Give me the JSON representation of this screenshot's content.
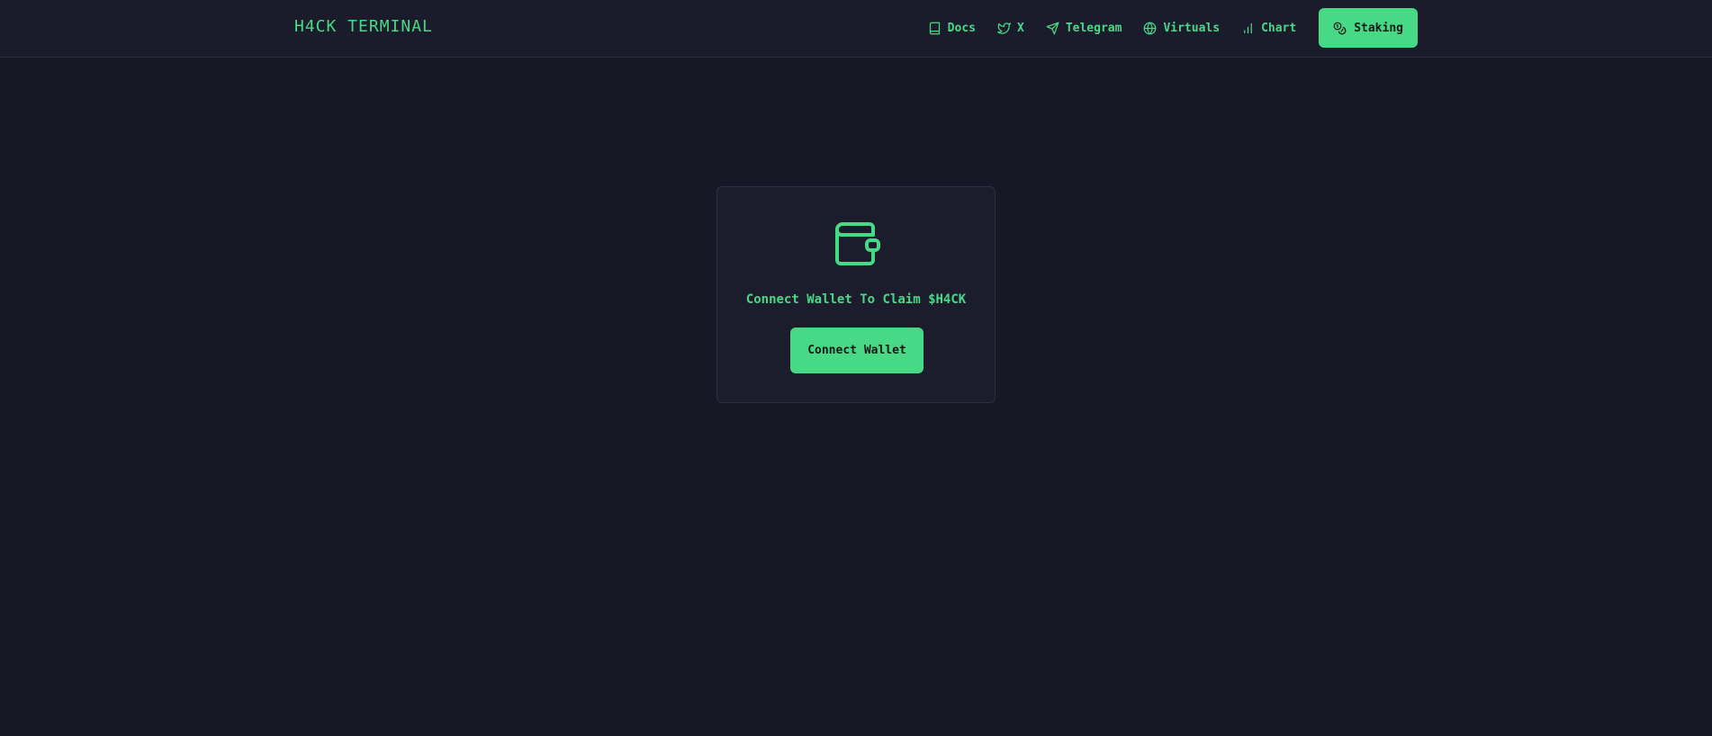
{
  "colors": {
    "accent": "#48d987",
    "background": "#161826",
    "header_bg": "#1a1c2c",
    "card_bg": "#1b1d2d",
    "button_text": "#0f1a14"
  },
  "header": {
    "logo": "H4CK TERMINAL",
    "nav": [
      {
        "label": "Docs",
        "icon": "book-icon"
      },
      {
        "label": "X",
        "icon": "twitter-bird-icon"
      },
      {
        "label": "Telegram",
        "icon": "send-icon"
      },
      {
        "label": "Virtuals",
        "icon": "globe-icon"
      },
      {
        "label": "Chart",
        "icon": "bar-chart-icon"
      }
    ],
    "staking": {
      "label": "Staking",
      "icon": "coins-icon"
    }
  },
  "claim_card": {
    "icon": "wallet-icon",
    "message": "Connect Wallet To Claim $H4CK",
    "button_label": "Connect Wallet"
  }
}
